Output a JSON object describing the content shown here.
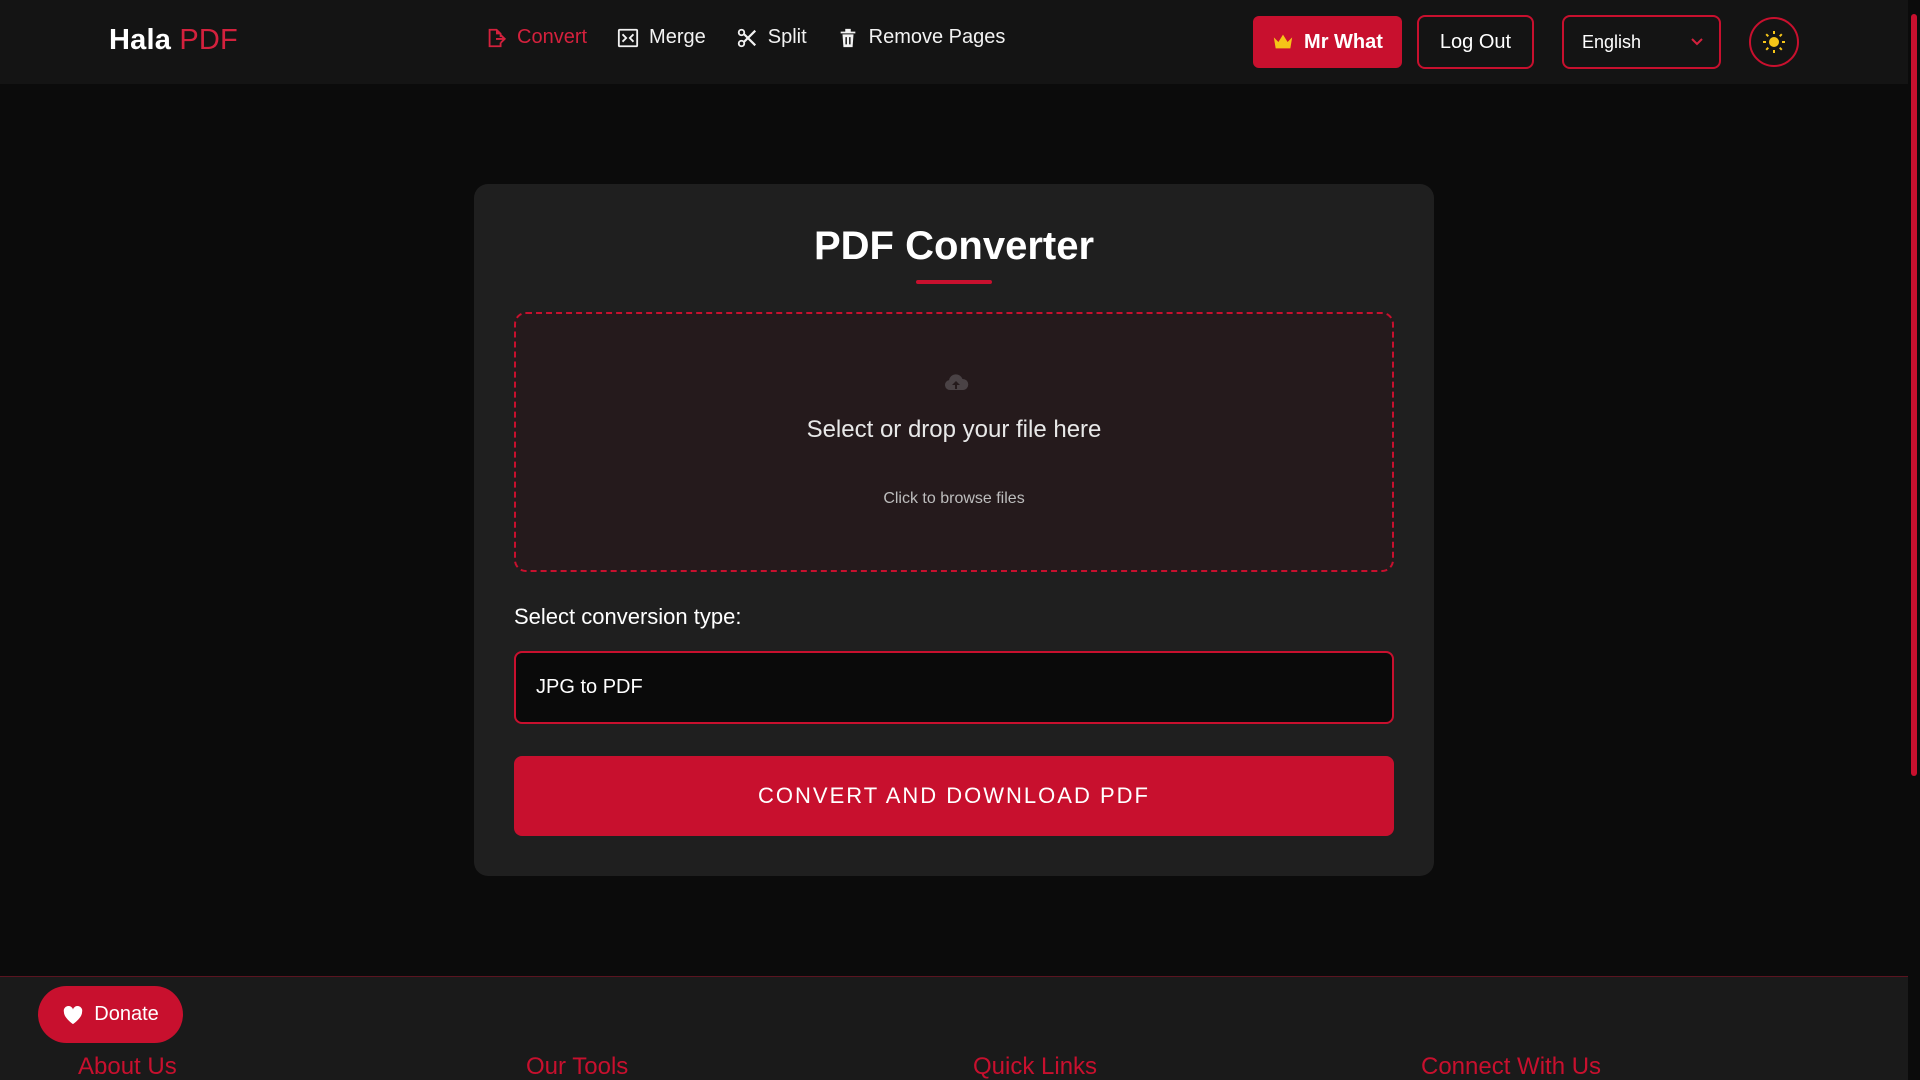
{
  "header": {
    "logo_main": "Hala",
    "logo_accent": "PDF",
    "nav": [
      {
        "label": "Convert",
        "icon": "file-export-icon"
      },
      {
        "label": "Merge",
        "icon": "merge-icon"
      },
      {
        "label": "Split",
        "icon": "scissors-icon"
      },
      {
        "label": "Remove Pages",
        "icon": "trash-icon"
      }
    ],
    "user_label": "Mr What",
    "logout_label": "Log Out",
    "language": "English"
  },
  "card": {
    "title": "PDF Converter",
    "dropzone_title": "Select or drop your file here",
    "dropzone_sub": "Click to browse files",
    "conversion_label": "Select conversion type:",
    "conversion_value": "JPG to PDF",
    "convert_button": "CONVERT AND DOWNLOAD PDF"
  },
  "footer": {
    "donate_label": "Donate",
    "headings": [
      "About Us",
      "Our Tools",
      "Quick Links",
      "Connect With Us"
    ]
  },
  "colors": {
    "accent": "#c8102e",
    "background": "#0b0b0b",
    "card": "#1f1f1f",
    "sun": "#f5c518"
  }
}
